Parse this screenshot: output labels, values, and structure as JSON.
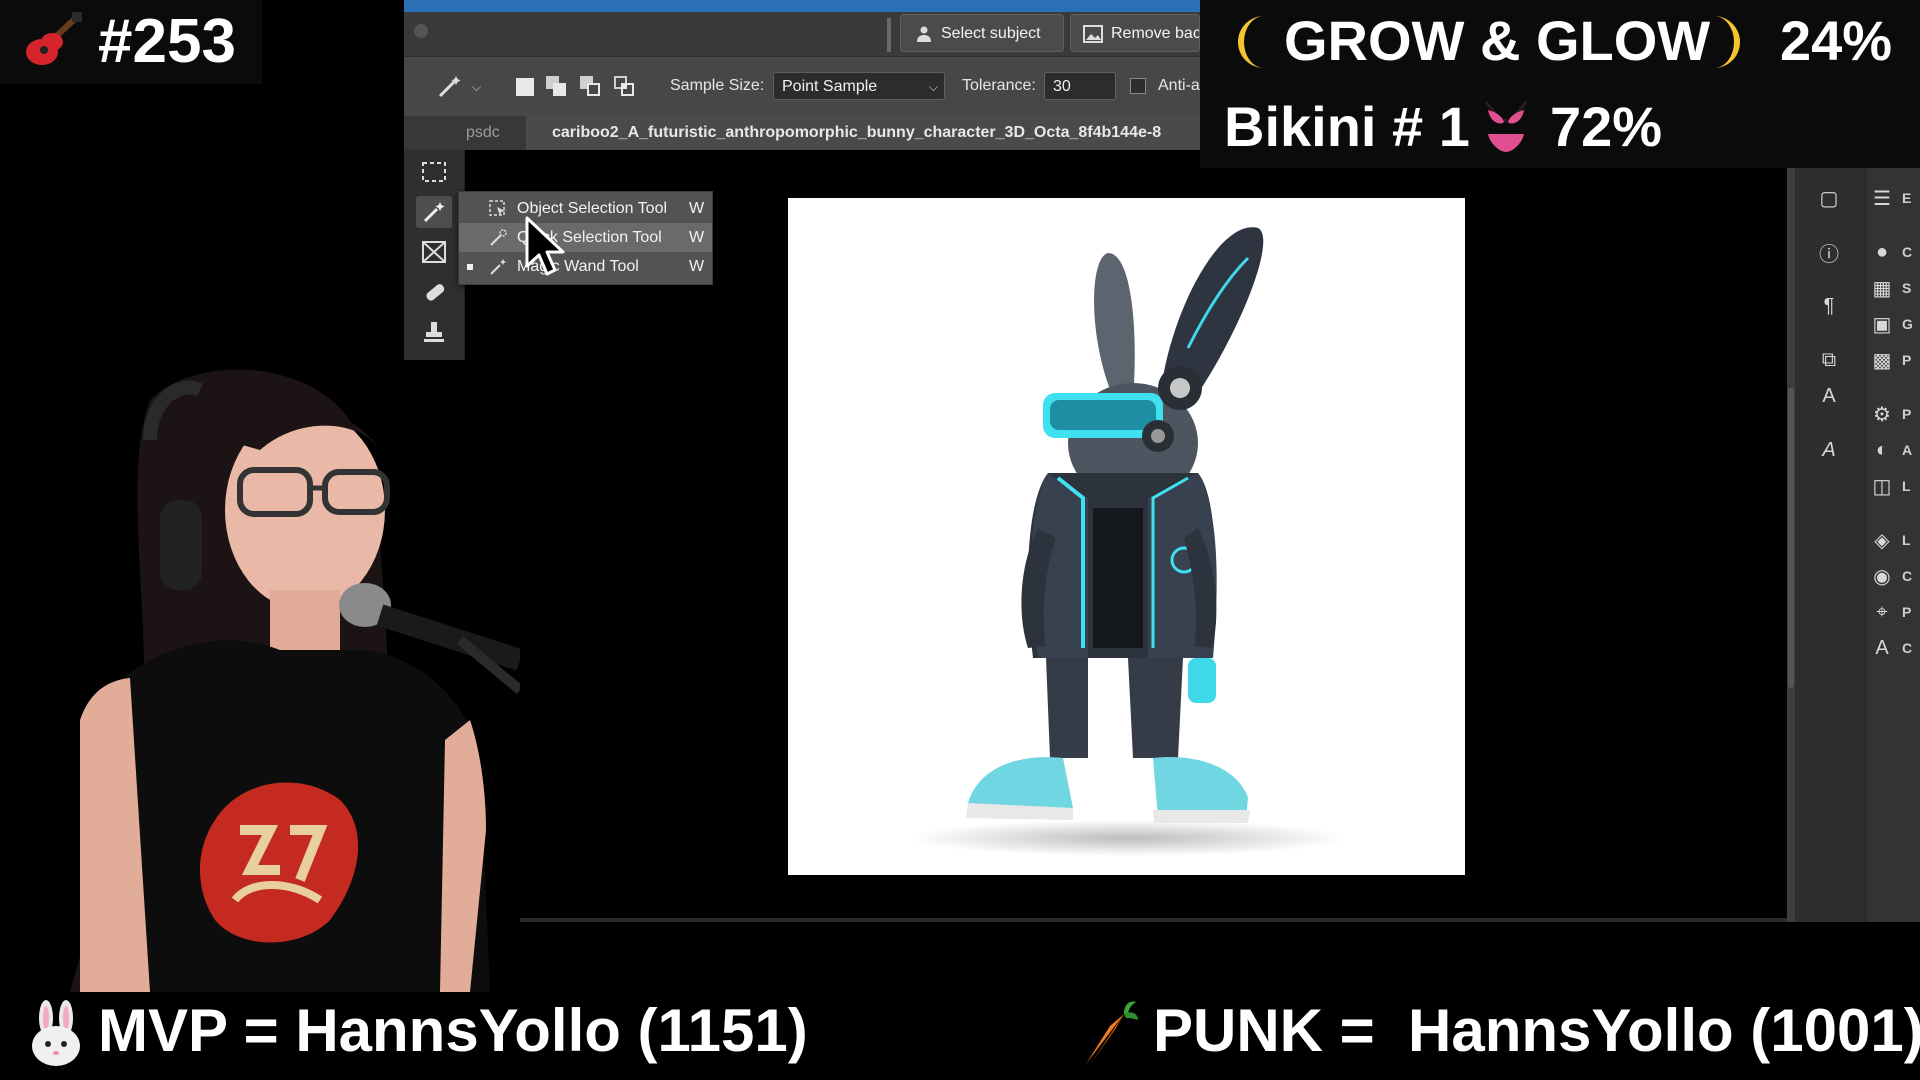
{
  "overlay": {
    "stream_number": "#253",
    "grow_glow_label": "GROW & GLOW",
    "grow_glow_pct": "24%",
    "bikini_label": "Bikini # 1",
    "bikini_pct": "72%",
    "mvp_text": "MVP = HannsYollo (1151)",
    "punk_text": "PUNK =  HannsYollo (1001)"
  },
  "photoshop": {
    "top_buttons": {
      "select_subject": "Select subject",
      "remove_background": "Remove bac"
    },
    "options_bar": {
      "sample_size_label": "Sample Size:",
      "sample_size_value": "Point Sample",
      "tolerance_label": "Tolerance:",
      "tolerance_value": "30",
      "anti_alias_label": "Anti-a"
    },
    "tabs": [
      {
        "label": "psdc"
      },
      {
        "label": "cariboo2_A_futuristic_anthropomorphic_bunny_character_3D_Octa_8f4b144e-8"
      }
    ],
    "tool_flyout": [
      {
        "label": "Object Selection Tool",
        "shortcut": "W"
      },
      {
        "label": "Quick Selection Tool",
        "shortcut": "W"
      },
      {
        "label": "Magic Wand Tool",
        "shortcut": "W"
      }
    ],
    "right_panel_letters": [
      "E",
      "C",
      "S",
      "G",
      "P",
      "P",
      "A",
      "L",
      "L",
      "C",
      "P",
      "C"
    ]
  },
  "colors": {
    "ps_dark": "#1e1e1e",
    "ps_panel": "#474747",
    "title_blue": "#2b6fb6",
    "accent_cyan": "#2fd3e6",
    "overlay_text": "#ffffff"
  }
}
